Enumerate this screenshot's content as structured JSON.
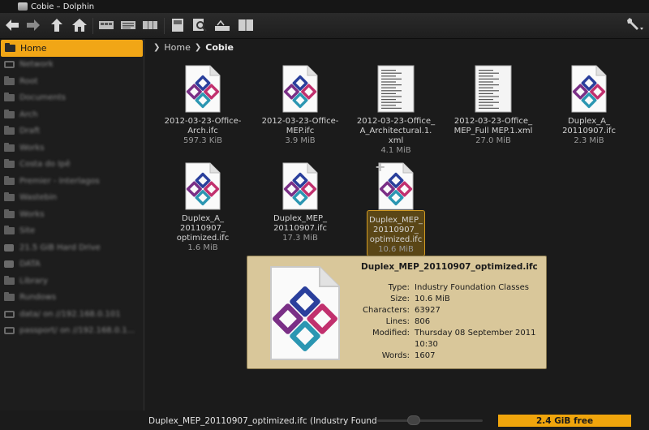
{
  "window": {
    "title": "Cobie – Dolphin"
  },
  "toolbar": {
    "buttons": [
      {
        "name": "back-button",
        "icon": "back-arrow-icon"
      },
      {
        "name": "forward-button",
        "icon": "forward-arrow-icon"
      },
      {
        "name": "up-button",
        "icon": "up-arrow-icon"
      },
      {
        "name": "home-button",
        "icon": "home-icon"
      },
      {
        "name": "icons-view-button",
        "icon": "icons-view-icon"
      },
      {
        "name": "details-view-button",
        "icon": "details-view-icon"
      },
      {
        "name": "columns-view-button",
        "icon": "columns-view-icon"
      },
      {
        "name": "preview-button",
        "icon": "preview-icon"
      },
      {
        "name": "find-button",
        "icon": "find-icon"
      },
      {
        "name": "compare-button",
        "icon": "compare-icon"
      },
      {
        "name": "split-button",
        "icon": "split-view-icon"
      },
      {
        "name": "configure-button",
        "icon": "wrench-icon"
      }
    ]
  },
  "sidebar": {
    "items": [
      {
        "label": "Home",
        "icon": "folder-icon",
        "active": true
      },
      {
        "label": "Network",
        "icon": "network-icon"
      },
      {
        "label": "Root",
        "icon": "folder-icon"
      },
      {
        "label": "Documents",
        "icon": "folder-icon"
      },
      {
        "label": "Arch",
        "icon": "folder-icon"
      },
      {
        "label": "Draft",
        "icon": "folder-icon"
      },
      {
        "label": "Works",
        "icon": "folder-icon"
      },
      {
        "label": "Costa do Ipê",
        "icon": "folder-icon"
      },
      {
        "label": "Premier - Interlagos",
        "icon": "folder-icon"
      },
      {
        "label": "Wastebin",
        "icon": "trash-icon"
      },
      {
        "label": "Works",
        "icon": "folder-icon"
      },
      {
        "label": "Site",
        "icon": "folder-icon"
      },
      {
        "label": "21.5 GiB Hard Drive",
        "icon": "drive-icon"
      },
      {
        "label": "DATA",
        "icon": "drive-icon"
      },
      {
        "label": "Library",
        "icon": "folder-icon"
      },
      {
        "label": "Rundows",
        "icon": "folder-icon"
      },
      {
        "label": "data/ on //192.168.0.101",
        "icon": "network-drive-icon"
      },
      {
        "label": "passport/ on //192.168.0.1...",
        "icon": "network-drive-icon"
      }
    ]
  },
  "breadcrumb": {
    "home": "Home",
    "current": "Cobie"
  },
  "files": [
    {
      "name": "2012-03-23-Office-Arch.ifc",
      "size": "597.3 KiB",
      "type": "ifc"
    },
    {
      "name": "2012-03-23-Office-MEP.ifc",
      "size": "3.9 MiB",
      "type": "ifc"
    },
    {
      "name": "2012-03-23-Office_A_Architectural.1.xml",
      "size": "4.1 MiB",
      "type": "xml"
    },
    {
      "name": "2012-03-23-Office_MEP_Full MEP.1.xml",
      "size": "27.0 MiB",
      "type": "xml"
    },
    {
      "name": "Duplex_A_20110907.ifc",
      "size": "2.3 MiB",
      "type": "ifc"
    },
    {
      "name": "Duplex_A_20110907_optimized.ifc",
      "size": "1.6 MiB",
      "type": "ifc"
    },
    {
      "name": "Duplex_MEP_20110907.ifc",
      "size": "17.3 MiB",
      "type": "ifc"
    },
    {
      "name": "Duplex_MEP_20110907_optimized.ifc",
      "size": "10.6 MiB",
      "type": "ifc",
      "selected": true
    }
  ],
  "file_labels": [
    [
      "2012-03-23-Office-",
      "Arch.ifc"
    ],
    [
      "2012-03-23-Office-",
      "MEP.ifc"
    ],
    [
      "2012-03-23-Office_",
      "A_Architectural.1.",
      "xml"
    ],
    [
      "2012-03-23-Office_",
      "MEP_Full MEP.1.xml"
    ],
    [
      "Duplex_A_",
      "20110907.ifc"
    ],
    [
      "Duplex_A_",
      "20110907_",
      "optimized.ifc"
    ],
    [
      "Duplex_MEP_",
      "20110907.ifc"
    ],
    [
      "Duplex_MEP_",
      "20110907_",
      "optimized.ifc"
    ]
  ],
  "tooltip": {
    "title": "Duplex_MEP_20110907_optimized.ifc",
    "rows": [
      {
        "key": "Type:",
        "value": "Industry Foundation Classes"
      },
      {
        "key": "Size:",
        "value": "10.6 MiB"
      },
      {
        "key": "Characters:",
        "value": "63927"
      },
      {
        "key": "Lines:",
        "value": "806"
      },
      {
        "key": "Modified:",
        "value": "Thursday 08 September 2011 10:30"
      },
      {
        "key": "Words:",
        "value": "1607"
      }
    ]
  },
  "statusbar": {
    "text": "Duplex_MEP_20110907_optimized.ifc (Industry Found",
    "free_space": "2.4 GiB free",
    "zoom_level": 0.35
  },
  "colors": {
    "accent": "#f1a616",
    "tooltip_bg": "#d9c79a",
    "ifc_blue": "#2a3f9c",
    "ifc_magenta": "#c1306e",
    "ifc_teal": "#2b96b2"
  }
}
